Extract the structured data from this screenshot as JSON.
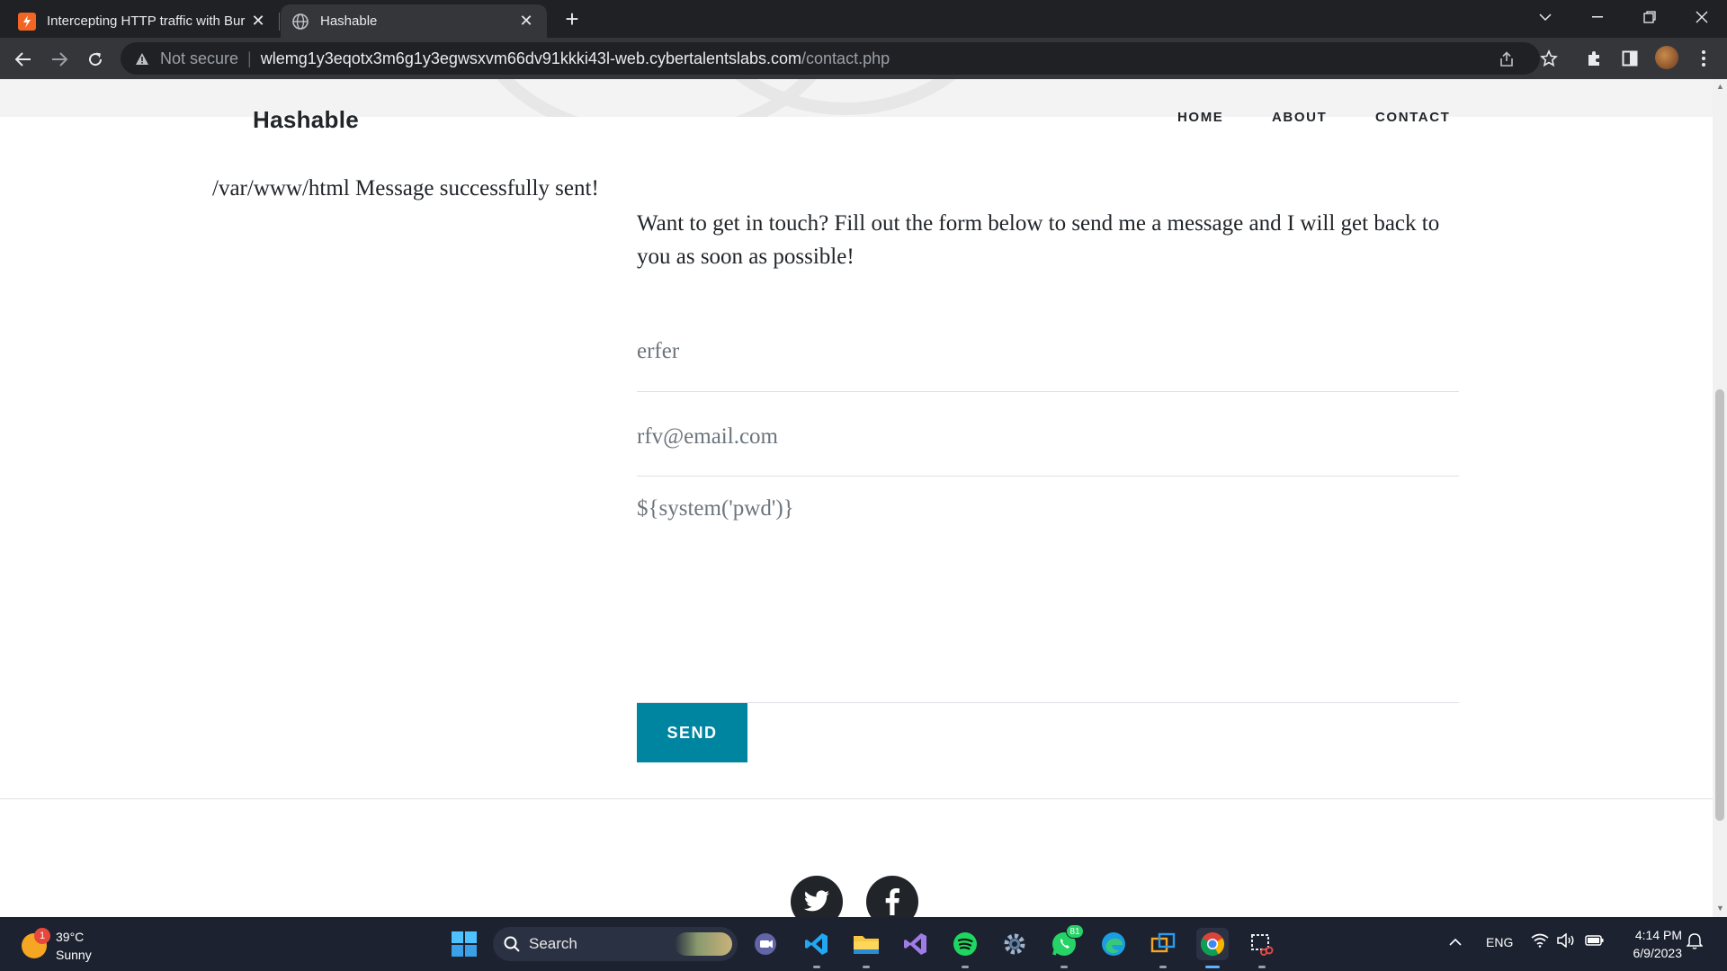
{
  "browser": {
    "tabs": [
      {
        "title": "Intercepting HTTP traffic with Bur",
        "icon": "burp-favicon-icon",
        "active": false
      },
      {
        "title": "Hashable",
        "icon": "globe-icon",
        "active": true
      }
    ],
    "security_label": "Not secure",
    "url_host": "wlemg1y3eqotx3m6g1y3egwsxvm66dv91kkki43l-web.cybertalentslabs.com",
    "url_path": "/contact.php"
  },
  "site": {
    "brand": "Hashable",
    "nav": [
      "HOME",
      "ABOUT",
      "CONTACT"
    ]
  },
  "page": {
    "output_message": "/var/www/html Message successfully sent!",
    "intro": "Want to get in touch? Fill out the form below to send me a message and I will get back to you as soon as possible!",
    "form": {
      "name_value": "erfer",
      "email_value": "rfv@email.com",
      "message_value": "${system('pwd')}",
      "send_label": "SEND"
    },
    "social": [
      "twitter-icon",
      "facebook-icon"
    ]
  },
  "taskbar": {
    "weather_temp": "39°C",
    "weather_desc": "Sunny",
    "weather_badge": "1",
    "search_label": "Search",
    "whatsapp_badge": "81",
    "language": "ENG",
    "time": "4:14 PM",
    "date": "6/9/2023"
  },
  "colors": {
    "accent": "#0085a1",
    "chrome_dark": "#202124",
    "taskbar": "#1c2230"
  }
}
